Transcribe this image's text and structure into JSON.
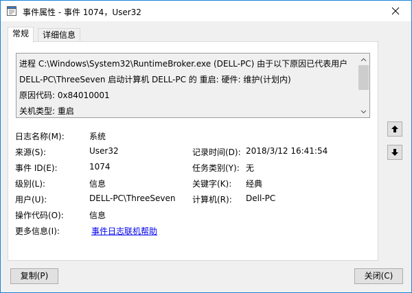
{
  "window": {
    "title": "事件属性 - 事件 1074，User32"
  },
  "tabs": [
    {
      "label": "常规",
      "active": true
    },
    {
      "label": "详细信息",
      "active": false
    }
  ],
  "description": {
    "lines": [
      "进程 C:\\Windows\\System32\\RuntimeBroker.exe (DELL-PC) 由于以下原因已代表用户",
      "DELL-PC\\ThreeSeven 启动计算机 DELL-PC 的 重启: 硬件: 维护(计划内)",
      "原因代码: 0x84010001",
      "关机类型: 重启"
    ]
  },
  "fields": {
    "log_name": {
      "label": "日志名称(M):",
      "value": "系统"
    },
    "source": {
      "label": "来源(S):",
      "value": "User32"
    },
    "logged": {
      "label": "记录时间(D):",
      "value": "2018/3/12 16:41:54"
    },
    "event_id": {
      "label": "事件 ID(E):",
      "value": "1074"
    },
    "task_category": {
      "label": "任务类别(Y):",
      "value": "无"
    },
    "level": {
      "label": "级别(L):",
      "value": "信息"
    },
    "keywords": {
      "label": "关键字(K):",
      "value": "经典"
    },
    "user": {
      "label": "用户(U):",
      "value": "DELL-PC\\ThreeSeven"
    },
    "computer": {
      "label": "计算机(R):",
      "value": "Dell-PC"
    },
    "opcode": {
      "label": "操作代码(O):",
      "value": "信息"
    },
    "more_info": {
      "label": "更多信息(I):",
      "link": "事件日志联机帮助"
    }
  },
  "buttons": {
    "copy": "复制(P)",
    "close": "关闭(C)"
  },
  "colors": {
    "accent_border": "#1883d7",
    "link": "#0000ee",
    "dialog_bg": "#f0f0f0"
  },
  "icons": {
    "title": "event-properties-icon",
    "close": "close-icon",
    "prev": "arrow-up-icon",
    "next": "arrow-down-icon"
  }
}
